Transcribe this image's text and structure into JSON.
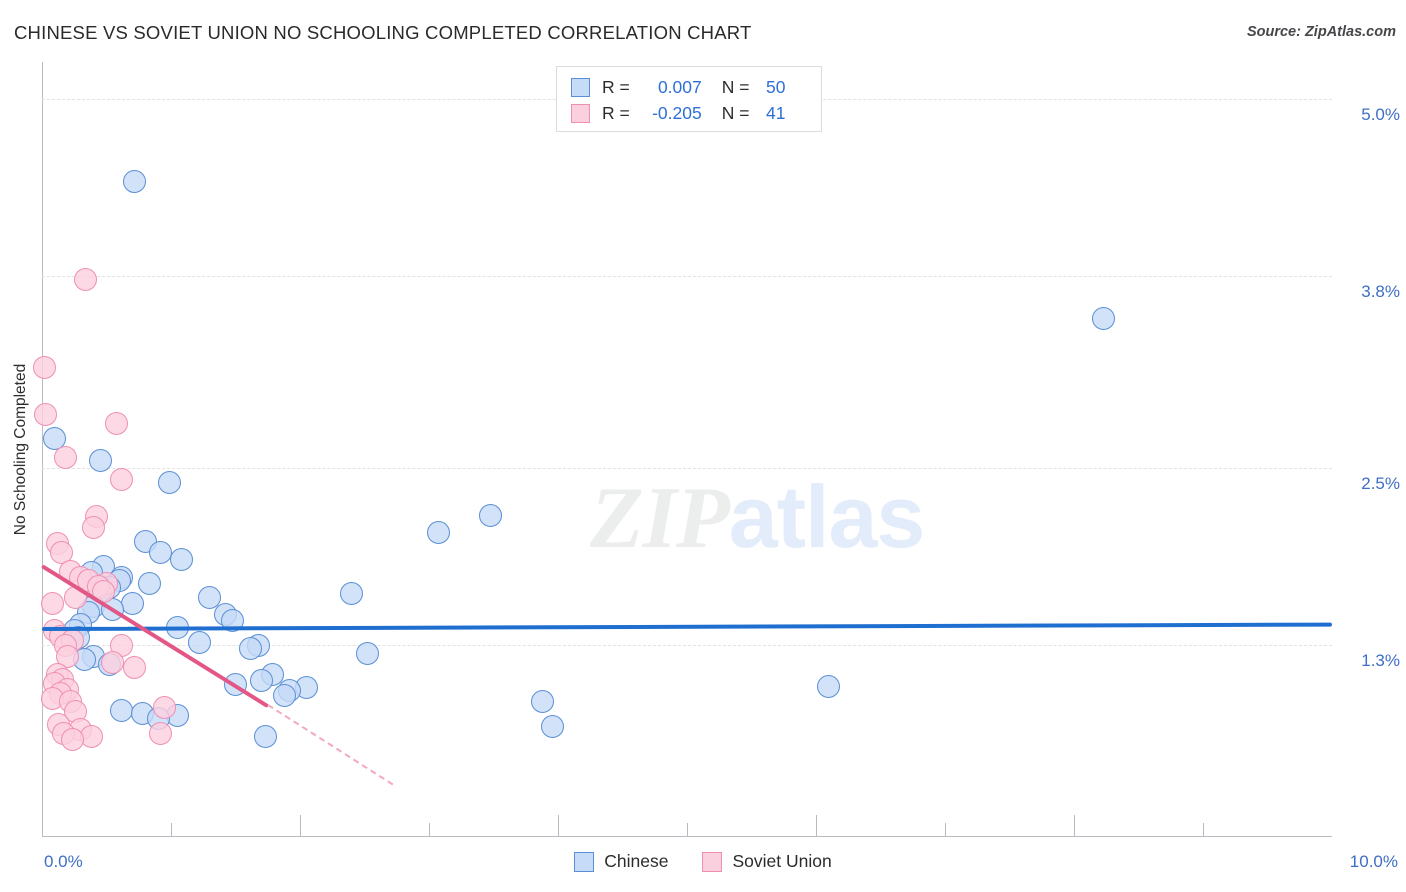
{
  "header": {
    "title": "CHINESE VS SOVIET UNION NO SCHOOLING COMPLETED CORRELATION CHART",
    "source": "Source: ZipAtlas.com"
  },
  "watermark": {
    "part1": "ZIP",
    "part2": "atlas"
  },
  "stat_legend": {
    "rows": [
      {
        "series": "Chinese",
        "r_label": "R =",
        "r_value": "0.007",
        "n_label": "N =",
        "n_value": "50",
        "color": "#c5dbf7"
      },
      {
        "series": "Soviet Union",
        "r_label": "R =",
        "r_value": "-0.205",
        "n_label": "N =",
        "n_value": "41",
        "color": "#fbd0de"
      }
    ]
  },
  "series_legend": [
    {
      "label": "Chinese",
      "color": "#c5dbf7"
    },
    {
      "label": "Soviet Union",
      "color": "#fbd0de"
    }
  ],
  "chart_data": {
    "type": "scatter",
    "title": "CHINESE VS SOVIET UNION NO SCHOOLING COMPLETED CORRELATION CHART",
    "xlabel": "",
    "ylabel": "No Schooling Completed",
    "xlim": [
      0.0,
      10.0
    ],
    "ylim": [
      0.0,
      5.25
    ],
    "x_tick_labels": [
      "0.0%",
      "10.0%"
    ],
    "y_tick_labels": [
      "5.0%",
      "3.8%",
      "2.5%",
      "1.3%"
    ],
    "y_tick_values": [
      5.0,
      3.8,
      2.5,
      1.3
    ],
    "grid": "horizontal-dashed",
    "legend_position": "bottom-center",
    "series": [
      {
        "name": "Chinese",
        "color": "#c5dbf7",
        "edge_color": "#5b8fd4",
        "R": 0.007,
        "N": 50,
        "trendline": {
          "x0": 0.0,
          "y0": 1.425,
          "x1": 10.0,
          "y1": 1.455,
          "style": "solid"
        },
        "points": [
          [
            0.72,
            4.44
          ],
          [
            8.23,
            3.51
          ],
          [
            0.1,
            2.7
          ],
          [
            0.45,
            2.55
          ],
          [
            0.99,
            2.4
          ],
          [
            3.48,
            2.18
          ],
          [
            3.07,
            2.06
          ],
          [
            0.8,
            2.0
          ],
          [
            0.92,
            1.93
          ],
          [
            1.08,
            1.88
          ],
          [
            0.48,
            1.83
          ],
          [
            0.38,
            1.79
          ],
          [
            0.62,
            1.76
          ],
          [
            0.6,
            1.74
          ],
          [
            0.83,
            1.72
          ],
          [
            0.52,
            1.69
          ],
          [
            0.45,
            1.66
          ],
          [
            2.4,
            1.65
          ],
          [
            1.3,
            1.62
          ],
          [
            0.7,
            1.58
          ],
          [
            0.4,
            1.56
          ],
          [
            0.55,
            1.54
          ],
          [
            0.36,
            1.52
          ],
          [
            1.42,
            1.51
          ],
          [
            1.48,
            1.47
          ],
          [
            0.3,
            1.44
          ],
          [
            1.05,
            1.42
          ],
          [
            0.25,
            1.4
          ],
          [
            0.28,
            1.35
          ],
          [
            1.22,
            1.32
          ],
          [
            1.68,
            1.3
          ],
          [
            1.62,
            1.28
          ],
          [
            2.52,
            1.24
          ],
          [
            0.4,
            1.22
          ],
          [
            0.33,
            1.2
          ],
          [
            0.52,
            1.17
          ],
          [
            1.79,
            1.1
          ],
          [
            1.7,
            1.06
          ],
          [
            1.5,
            1.03
          ],
          [
            2.05,
            1.01
          ],
          [
            6.1,
            1.02
          ],
          [
            1.92,
            0.99
          ],
          [
            1.88,
            0.96
          ],
          [
            3.88,
            0.92
          ],
          [
            0.62,
            0.86
          ],
          [
            0.78,
            0.84
          ],
          [
            1.05,
            0.82
          ],
          [
            0.9,
            0.8
          ],
          [
            3.96,
            0.75
          ],
          [
            1.73,
            0.68
          ]
        ]
      },
      {
        "name": "Soviet Union",
        "color": "#fbd0de",
        "edge_color": "#ef8fb2",
        "R": -0.205,
        "N": 41,
        "trendline": {
          "x0": 0.0,
          "y0": 1.85,
          "x1": 1.75,
          "y1": 0.9,
          "style": "solid-then-dashed",
          "dash_to": {
            "x": 2.72,
            "y": 0.36
          }
        },
        "points": [
          [
            0.34,
            3.78
          ],
          [
            0.02,
            3.18
          ],
          [
            0.03,
            2.86
          ],
          [
            0.58,
            2.8
          ],
          [
            0.18,
            2.57
          ],
          [
            0.62,
            2.42
          ],
          [
            0.42,
            2.17
          ],
          [
            0.4,
            2.1
          ],
          [
            0.12,
            1.99
          ],
          [
            0.15,
            1.93
          ],
          [
            0.22,
            1.8
          ],
          [
            0.3,
            1.76
          ],
          [
            0.36,
            1.74
          ],
          [
            0.5,
            1.72
          ],
          [
            0.44,
            1.7
          ],
          [
            0.48,
            1.66
          ],
          [
            0.26,
            1.62
          ],
          [
            0.08,
            1.58
          ],
          [
            0.1,
            1.4
          ],
          [
            0.14,
            1.36
          ],
          [
            0.24,
            1.33
          ],
          [
            0.18,
            1.3
          ],
          [
            0.62,
            1.3
          ],
          [
            0.2,
            1.22
          ],
          [
            0.55,
            1.18
          ],
          [
            0.72,
            1.15
          ],
          [
            0.12,
            1.1
          ],
          [
            0.16,
            1.07
          ],
          [
            0.1,
            1.04
          ],
          [
            0.2,
            1.0
          ],
          [
            0.14,
            0.97
          ],
          [
            0.08,
            0.94
          ],
          [
            0.22,
            0.92
          ],
          [
            0.95,
            0.88
          ],
          [
            0.26,
            0.85
          ],
          [
            0.13,
            0.76
          ],
          [
            0.3,
            0.73
          ],
          [
            0.17,
            0.7
          ],
          [
            0.38,
            0.68
          ],
          [
            0.24,
            0.66
          ],
          [
            0.92,
            0.7
          ]
        ]
      }
    ]
  }
}
